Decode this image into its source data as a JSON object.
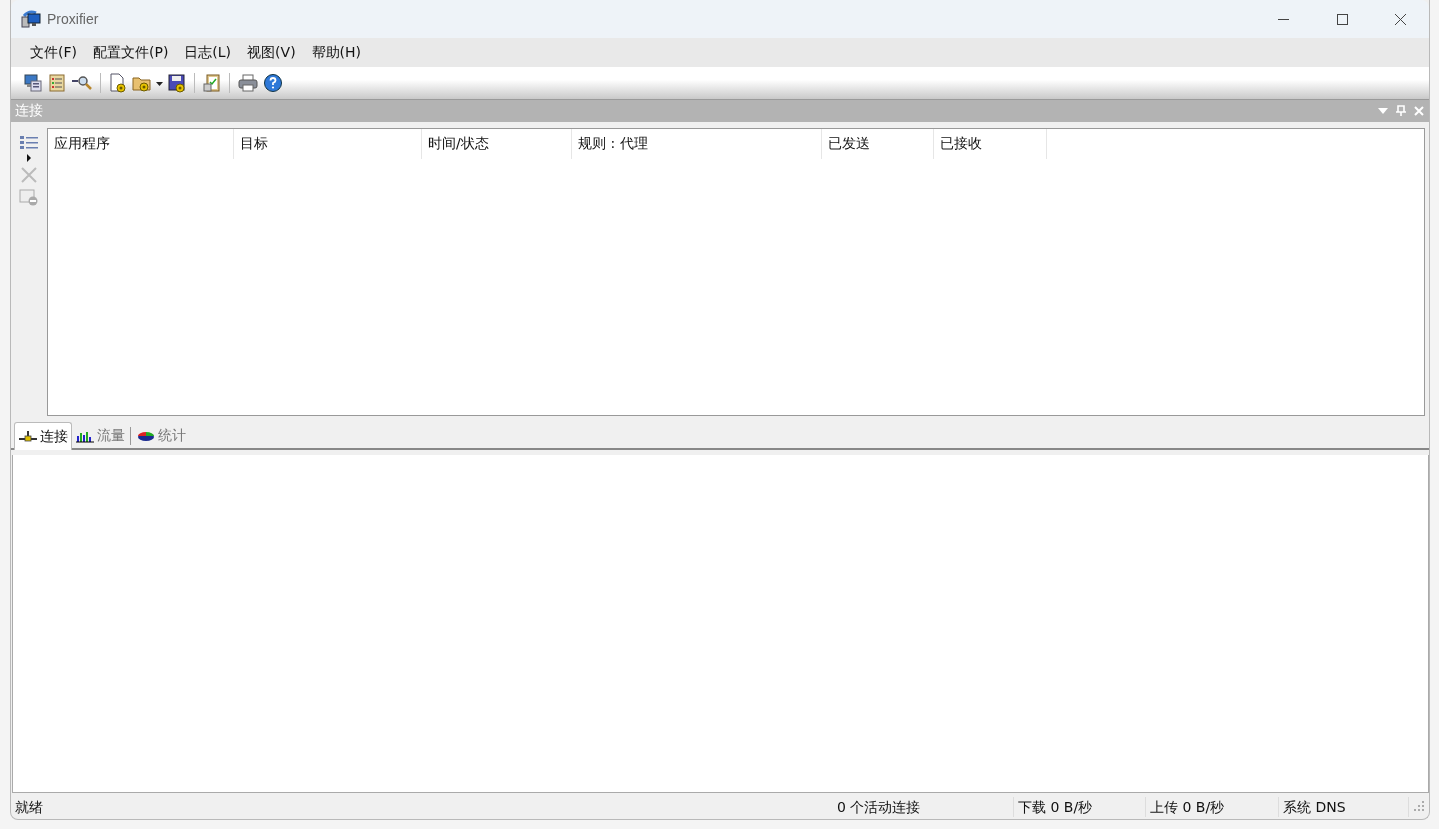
{
  "window": {
    "title": "Proxifier"
  },
  "menu": [
    "文件(F)",
    "配置文件(P)",
    "日志(L)",
    "视图(V)",
    "帮助(H)"
  ],
  "panel": {
    "title": "连接"
  },
  "table": {
    "columns": [
      "应用程序",
      "目标",
      "时间/状态",
      "规则 : 代理",
      "已发送",
      "已接收"
    ]
  },
  "tabs": [
    {
      "label": "连接",
      "selected": true
    },
    {
      "label": "流量",
      "selected": false
    },
    {
      "label": "统计",
      "selected": false
    }
  ],
  "status_bar": [
    "就绪",
    "0 个活动连接",
    "下载 0 B/秒",
    "上传 0 B/秒",
    "系统 DNS"
  ]
}
